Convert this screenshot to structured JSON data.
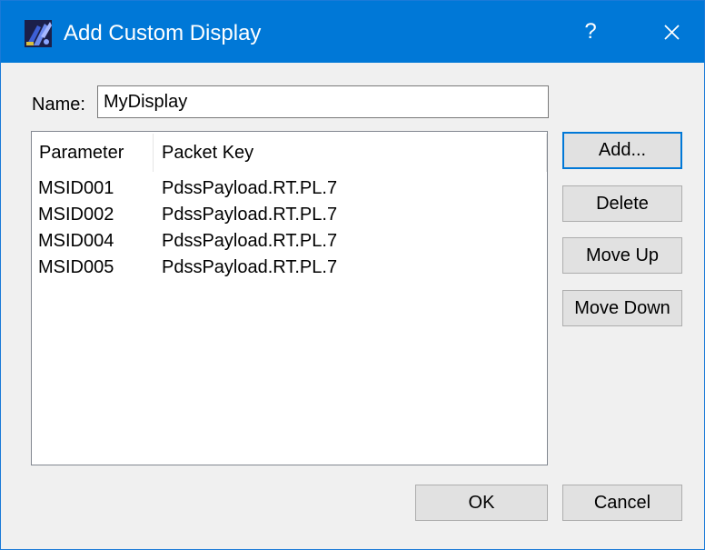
{
  "window": {
    "title": "Add Custom Display",
    "help_glyph": "?",
    "app_icon": "app-logo-icon",
    "close_icon": "close-icon",
    "titlebar_color": "#0078d7"
  },
  "name_field": {
    "label": "Name:",
    "value": "MyDisplay"
  },
  "table": {
    "columns": [
      "Parameter",
      "Packet Key"
    ],
    "rows": [
      {
        "parameter": "MSID001",
        "packet_key": "PdssPayload.RT.PL.7"
      },
      {
        "parameter": "MSID002",
        "packet_key": "PdssPayload.RT.PL.7"
      },
      {
        "parameter": "MSID004",
        "packet_key": "PdssPayload.RT.PL.7"
      },
      {
        "parameter": "MSID005",
        "packet_key": "PdssPayload.RT.PL.7"
      }
    ]
  },
  "side_buttons": {
    "add": "Add...",
    "delete": "Delete",
    "move_up": "Move Up",
    "move_down": "Move Down"
  },
  "footer_buttons": {
    "ok": "OK",
    "cancel": "Cancel"
  }
}
